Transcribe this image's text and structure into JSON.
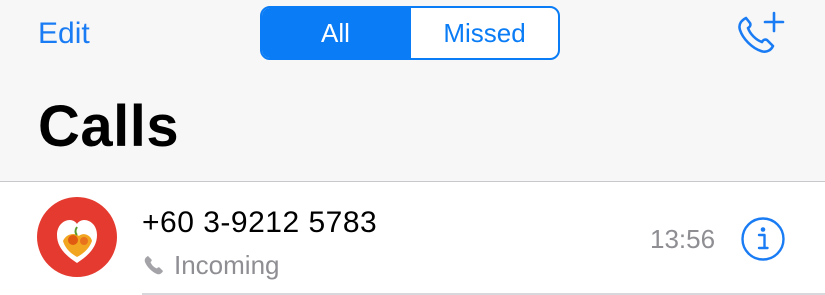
{
  "header": {
    "edit_label": "Edit",
    "segments": [
      {
        "label": "All",
        "active": true
      },
      {
        "label": "Missed",
        "active": false
      }
    ],
    "new_call_icon": "phone-plus-icon",
    "title": "Calls"
  },
  "calls": [
    {
      "number": "+60 3-9212 5783",
      "direction_icon": "phone-icon",
      "direction": "Incoming",
      "time": "13:56",
      "info_icon": "info-circle-icon"
    }
  ],
  "colors": {
    "accent": "#0a7cf5",
    "avatar_bg": "#e53a2f",
    "secondary_text": "#8e8e93",
    "header_bg": "#f7f7f7"
  }
}
